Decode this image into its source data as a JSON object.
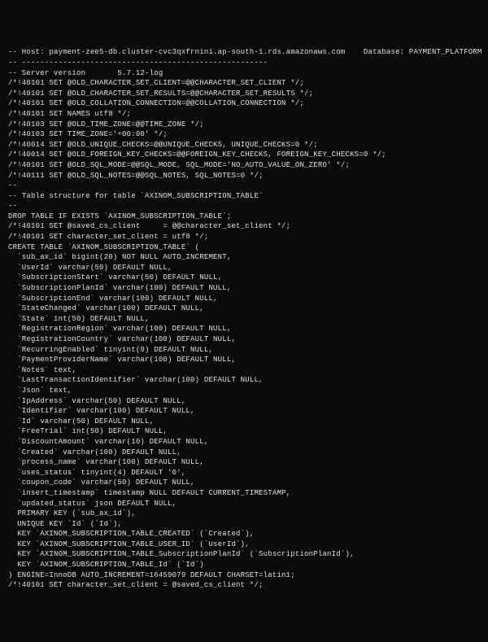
{
  "lines": [
    "-- Host: payment-zee5-db.cluster-cvc3qxfrnini.ap-south-1.rds.amazonaws.com    Database: PAYMENT_PLATFORM",
    "-- ------------------------------------------------------",
    "-- Server version       5.7.12-log",
    "",
    "/*!40101 SET @OLD_CHARACTER_SET_CLIENT=@@CHARACTER_SET_CLIENT */;",
    "/*!40101 SET @OLD_CHARACTER_SET_RESULTS=@@CHARACTER_SET_RESULTS */;",
    "/*!40101 SET @OLD_COLLATION_CONNECTION=@@COLLATION_CONNECTION */;",
    "/*!40101 SET NAMES utf8 */;",
    "/*!40103 SET @OLD_TIME_ZONE=@@TIME_ZONE */;",
    "/*!40103 SET TIME_ZONE='+00:00' */;",
    "/*!40014 SET @OLD_UNIQUE_CHECKS=@@UNIQUE_CHECKS, UNIQUE_CHECKS=0 */;",
    "/*!40014 SET @OLD_FOREIGN_KEY_CHECKS=@@FOREIGN_KEY_CHECKS, FOREIGN_KEY_CHECKS=0 */;",
    "/*!40101 SET @OLD_SQL_MODE=@@SQL_MODE, SQL_MODE='NO_AUTO_VALUE_ON_ZERO' */;",
    "/*!40111 SET @OLD_SQL_NOTES=@@SQL_NOTES, SQL_NOTES=0 */;",
    "",
    "--",
    "-- Table structure for table `AXINOM_SUBSCRIPTION_TABLE`",
    "--",
    "",
    "DROP TABLE IF EXISTS `AXINOM_SUBSCRIPTION_TABLE`;",
    "/*!40101 SET @saved_cs_client     = @@character_set_client */;",
    "/*!40101 SET character_set_client = utf8 */;",
    "CREATE TABLE `AXINOM_SUBSCRIPTION_TABLE` (",
    "  `sub_ax_id` bigint(20) NOT NULL AUTO_INCREMENT,",
    "  `UserId` varchar(50) DEFAULT NULL,",
    "  `SubscriptionStart` varchar(50) DEFAULT NULL,",
    "  `SubscriptionPlanId` varchar(100) DEFAULT NULL,",
    "  `SubscriptionEnd` varchar(100) DEFAULT NULL,",
    "  `StateChanged` varchar(100) DEFAULT NULL,",
    "  `State` int(50) DEFAULT NULL,",
    "  `RegistrationRegion` varchar(100) DEFAULT NULL,",
    "  `RegistrationCountry` varchar(100) DEFAULT NULL,",
    "  `RecurringEnabled` tinyint(9) DEFAULT NULL,",
    "  `PaymentProviderName` varchar(100) DEFAULT NULL,",
    "  `Notes` text,",
    "  `LastTransactionIdentifier` varchar(100) DEFAULT NULL,",
    "  `Json` text,",
    "  `IpAddress` varchar(50) DEFAULT NULL,",
    "  `Identifier` varchar(100) DEFAULT NULL,",
    "  `Id` varchar(50) DEFAULT NULL,",
    "  `FreeTrial` int(50) DEFAULT NULL,",
    "  `DiscountAmount` varchar(10) DEFAULT NULL,",
    "  `Created` varchar(100) DEFAULT NULL,",
    "  `process_name` varchar(100) DEFAULT NULL,",
    "  `uses_status` tinyint(4) DEFAULT '0',",
    "  `coupon_code` varchar(50) DEFAULT NULL,",
    "  `insert_timestamp` timestamp NULL DEFAULT CURRENT_TIMESTAMP,",
    "  `updated_status` json DEFAULT NULL,",
    "  PRIMARY KEY (`sub_ax_id`),",
    "  UNIQUE KEY `Id` (`Id`),",
    "  KEY `AXINOM_SUBSCRIPTION_TABLE_CREATED` (`Created`),",
    "  KEY `AXINOM_SUBSCRIPTION_TABLE_USER_ID` (`UserId`),",
    "  KEY `AXINOM_SUBSCRIPTION_TABLE_SubscriptionPlanId` (`SubscriptionPlanId`),",
    "  KEY `AXINOM_SUBSCRIPTION_TABLE_Id` (`Id`)",
    ") ENGINE=InnoDB AUTO_INCREMENT=16459079 DEFAULT CHARSET=latin1;",
    "/*!40101 SET character_set_client = @saved_cs_client */;"
  ]
}
